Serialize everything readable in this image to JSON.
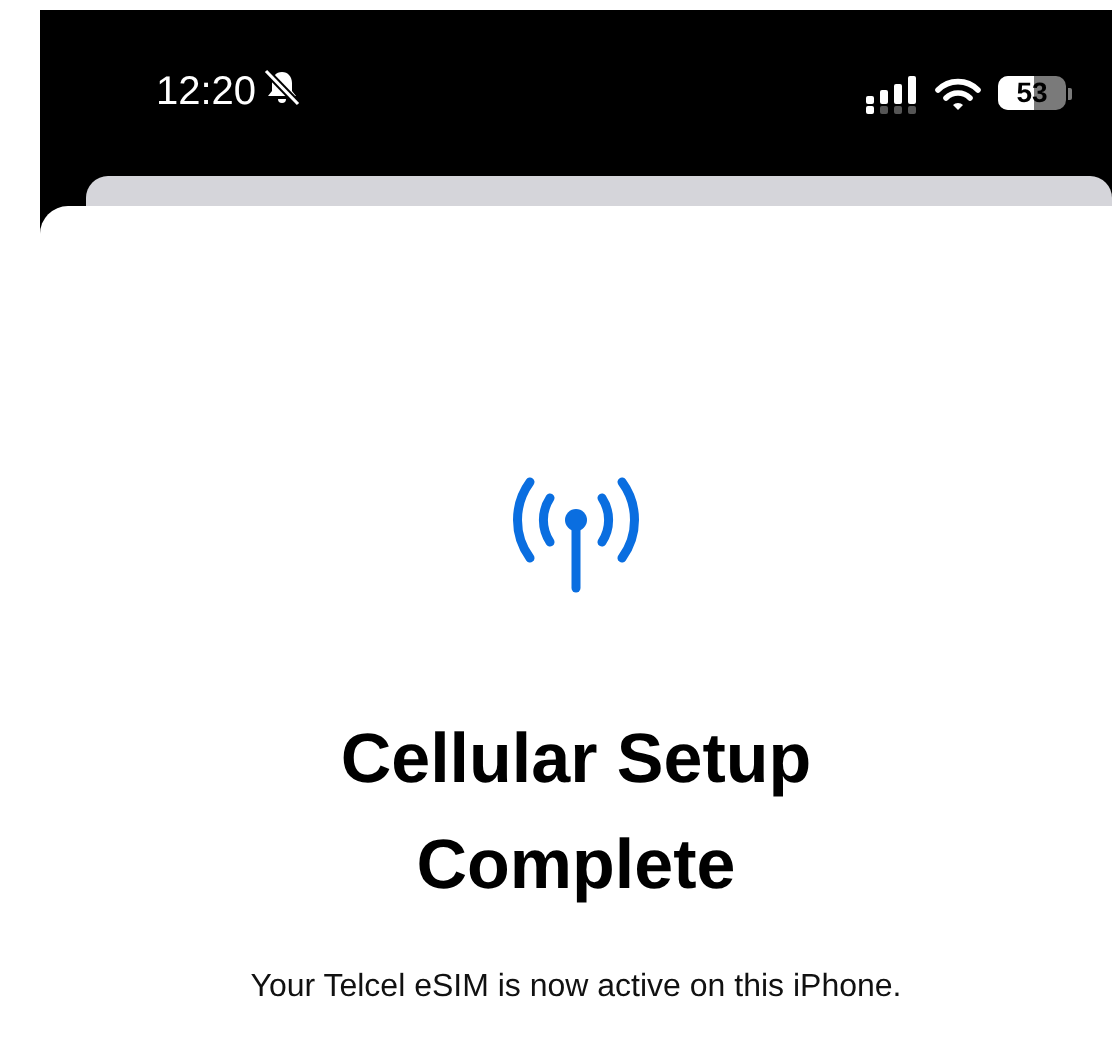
{
  "status_bar": {
    "time": "12:20",
    "silent": true,
    "battery": {
      "text": "53",
      "level": 0.53
    }
  },
  "sheet": {
    "title": "Cellular Setup Complete",
    "message": "Your Telcel eSIM is now active on this iPhone."
  }
}
